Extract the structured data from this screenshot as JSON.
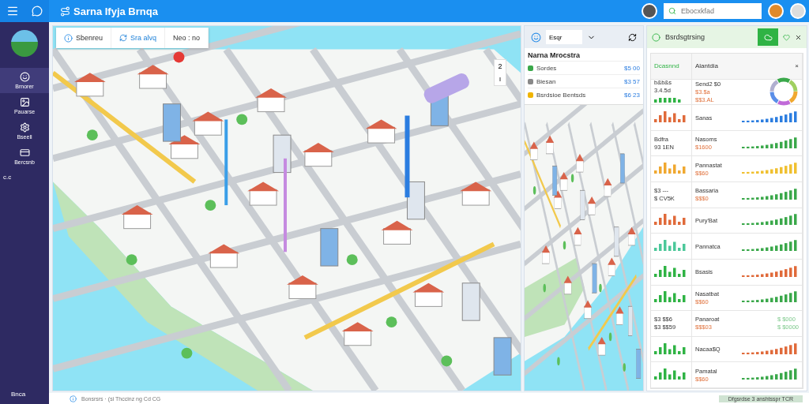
{
  "header": {
    "title": "Sarna Ifyja Brnqa",
    "search": {
      "placeholder": "Ebocxkfad"
    }
  },
  "sidebar": {
    "items": [
      {
        "label": "Brnorer",
        "selected": true
      },
      {
        "label": "Pauarse",
        "selected": false
      },
      {
        "label": "Bseell",
        "selected": false
      },
      {
        "label": "Bercsnb",
        "selected": false
      }
    ],
    "extra": "c.c",
    "footer": "Bnca"
  },
  "map": {
    "tabs": [
      {
        "label": "Sbenreu",
        "selected": false
      },
      {
        "label": "Sra alvq",
        "selected": true
      },
      {
        "label": "Neo : no",
        "selected": false
      }
    ],
    "zoom": [
      "2",
      "ı"
    ]
  },
  "list_panel": {
    "dropdown": "Esqr",
    "title": "Narna Mrocstra",
    "items": [
      {
        "label": "Sordes",
        "value": "$5 00",
        "color": "#3aa84a"
      },
      {
        "label": "Biesan",
        "value": "$3 57",
        "color": "#888888"
      },
      {
        "label": "Bsrdsioe Bentsds",
        "value": "$6 23",
        "color": "#f0b400"
      }
    ]
  },
  "stats_panel": {
    "title": "Bsrdsgtrsing",
    "columns": [
      "Dcasnnd",
      "Alantdia"
    ],
    "close": "×",
    "rows": [
      {
        "col1": [
          "b&b&s",
          "3.4.5d"
        ],
        "mini_chart": {
          "color": "#2fb344"
        },
        "name": [
          "Send2 $0",
          "$3.$a",
          "$$3.AL"
        ],
        "kind": "donut"
      },
      {
        "mini_chart": {
          "color": "#e06a3a"
        },
        "name": [
          "Sanas"
        ],
        "kind": "bars",
        "color": "#2b7de0"
      },
      {
        "col1": [
          "Bdfra",
          "93 1EN"
        ],
        "name": [
          "Nasoms",
          "$1600"
        ],
        "kind": "bars",
        "color": "#3aa84a"
      },
      {
        "mini_chart": {
          "color": "#f0a830"
        },
        "name": [
          "Pannastat",
          "$$60"
        ],
        "kind": "bars",
        "color": "#f0c030"
      },
      {
        "col1": [
          "$3 ---",
          "$ CV5K"
        ],
        "name": [
          "Bassaria",
          "$$$0"
        ],
        "kind": "bars",
        "color": "#3aa84a"
      },
      {
        "mini_chart": {
          "color": "#e06a3a"
        },
        "name": [
          "Pury'Bat"
        ],
        "kind": "bars",
        "color": "#3aa84a"
      },
      {
        "mini_chart": {
          "color": "#4cc89a"
        },
        "name": [
          "Pannatca"
        ],
        "kind": "bars",
        "color": "#3aa84a"
      },
      {
        "mini_chart": {
          "color": "#2fb344"
        },
        "name": [
          "Bsasis"
        ],
        "kind": "bars",
        "color": "#e06a3a"
      },
      {
        "mini_chart": {
          "color": "#2fb344"
        },
        "name": [
          "Nasatbat",
          "$$60"
        ],
        "kind": "bars",
        "color": "#3aa84a"
      },
      {
        "col1": [
          "$3 $$6",
          "$3 $$59"
        ],
        "name": [
          "Panaroat",
          "$$$03"
        ],
        "kind": "text",
        "extra": [
          "$ $000",
          "$ $0000"
        ]
      },
      {
        "mini_chart": {
          "color": "#2fb344"
        },
        "name": [
          "Nacaa$Q"
        ],
        "kind": "bars",
        "color": "#e06a3a"
      },
      {
        "mini_chart": {
          "color": "#2fb344"
        },
        "name": [
          "Pamatal",
          "$$60"
        ],
        "kind": "bars",
        "color": "#3aa84a"
      }
    ]
  },
  "status_bar": {
    "text": "Bonsrsrs · (si Thccinz ng Cd CG",
    "button": "Dfgsrdse 3 anshtsspr TCR"
  }
}
